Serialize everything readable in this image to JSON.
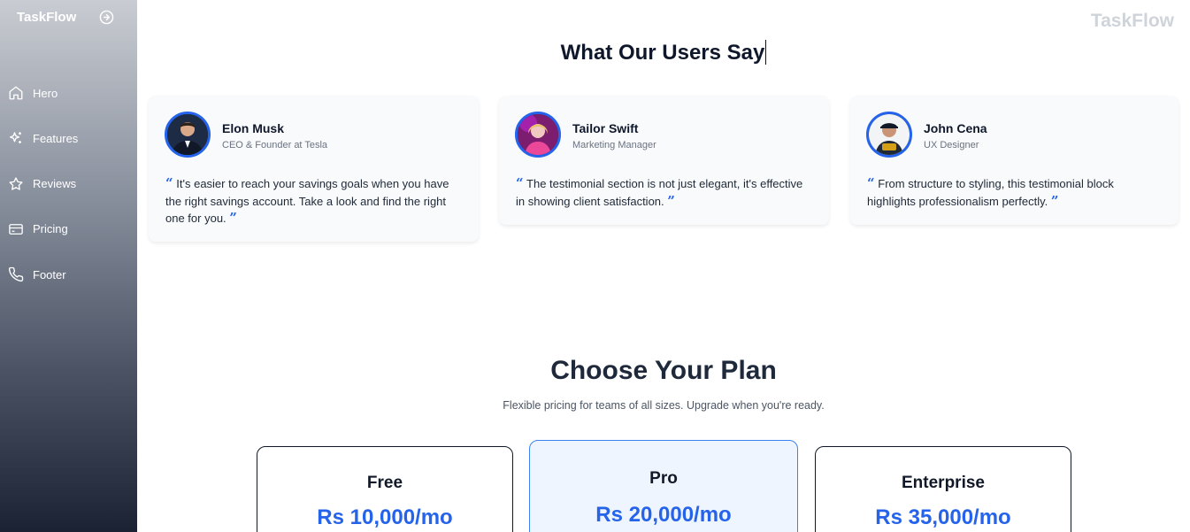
{
  "sidebar": {
    "brand": "TaskFlow",
    "items": [
      {
        "label": "Hero",
        "icon": "home-icon"
      },
      {
        "label": "Features",
        "icon": "sparkles-icon"
      },
      {
        "label": "Reviews",
        "icon": "star-icon"
      },
      {
        "label": "Pricing",
        "icon": "credit-card-icon"
      },
      {
        "label": "Footer",
        "icon": "phone-icon"
      }
    ]
  },
  "header": {
    "brand": "TaskFlow"
  },
  "testimonials": {
    "title": "What Our Users Say",
    "items": [
      {
        "name": "Elon Musk",
        "role": "CEO & Founder at Tesla",
        "quote": "It's easier to reach your savings goals when you have the right savings account. Take a look and find the right one for you."
      },
      {
        "name": "Tailor Swift",
        "role": "Marketing Manager",
        "quote": "The testimonial section is not just elegant, it's effective in showing client satisfaction."
      },
      {
        "name": "John Cena",
        "role": "UX Designer",
        "quote": "From structure to styling, this testimonial block highlights professionalism perfectly."
      }
    ]
  },
  "pricing": {
    "title": "Choose Your Plan",
    "subtitle": "Flexible pricing for teams of all sizes. Upgrade when you're ready.",
    "plans": [
      {
        "name": "Free",
        "price": "Rs 10,000/mo"
      },
      {
        "name": "Pro",
        "price": "Rs 20,000/mo"
      },
      {
        "name": "Enterprise",
        "price": "Rs 35,000/mo"
      }
    ]
  },
  "colors": {
    "accent": "#2563eb",
    "sidebar_top": "#c9ccd2",
    "sidebar_bottom": "#1b2234"
  }
}
